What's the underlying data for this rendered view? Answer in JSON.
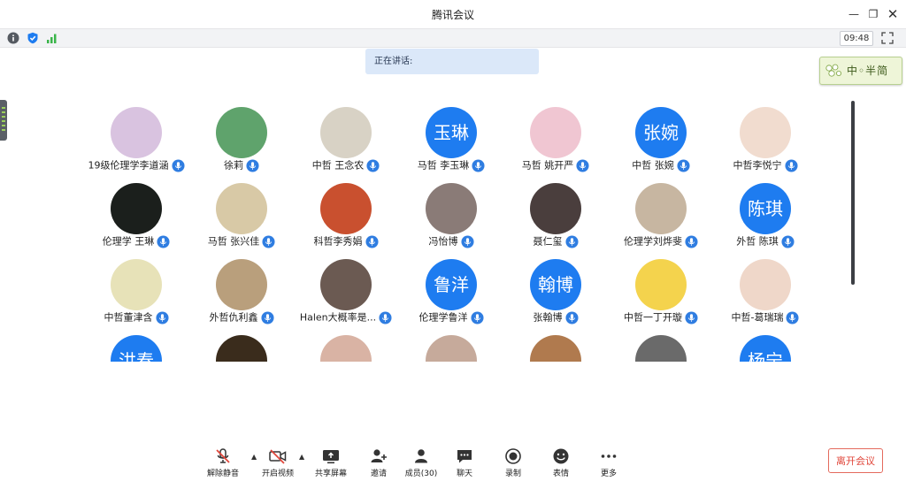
{
  "window": {
    "title": "腾讯会议",
    "minimize": "—",
    "restore": "❐",
    "close": "✕"
  },
  "infobar": {
    "time": "09:48",
    "colors": {
      "info": "#555a61",
      "shield": "#1e7cf0",
      "signal": "#3bb54a"
    }
  },
  "speaking": {
    "label": "正在讲话:"
  },
  "logo": {
    "text": "中◦半简"
  },
  "participants": [
    {
      "name": "19级伦理学李道涵",
      "avatar_text": "",
      "avatar_color": "#d9c3e0"
    },
    {
      "name": "徐莉",
      "avatar_text": "",
      "avatar_color": "#5fa36c"
    },
    {
      "name": "中哲 王念农",
      "avatar_text": "",
      "avatar_color": "#d8d2c5"
    },
    {
      "name": "马哲 李玉琳",
      "avatar_text": "玉琳",
      "avatar_color": "#1e7cf0"
    },
    {
      "name": "马哲 姚开严",
      "avatar_text": "",
      "avatar_color": "#f0c6d2"
    },
    {
      "name": "中哲 张婉",
      "avatar_text": "张婉",
      "avatar_color": "#1e7cf0"
    },
    {
      "name": "中哲李悦宁",
      "avatar_text": "",
      "avatar_color": "#f1dccf"
    },
    {
      "name": "伦理学 王琳",
      "avatar_text": "",
      "avatar_color": "#1b1f1c"
    },
    {
      "name": "马哲 张兴佳",
      "avatar_text": "",
      "avatar_color": "#d8c9a6"
    },
    {
      "name": "科哲李秀娟",
      "avatar_text": "",
      "avatar_color": "#c9502f"
    },
    {
      "name": "冯怡博",
      "avatar_text": "",
      "avatar_color": "#8a7b77"
    },
    {
      "name": "聂仁玺",
      "avatar_text": "",
      "avatar_color": "#4a3e3d"
    },
    {
      "name": "伦理学刘烨斐",
      "avatar_text": "",
      "avatar_color": "#c7b6a1"
    },
    {
      "name": "外哲 陈琪",
      "avatar_text": "陈琪",
      "avatar_color": "#1e7cf0"
    },
    {
      "name": "中哲董津含",
      "avatar_text": "",
      "avatar_color": "#e7e2b8"
    },
    {
      "name": "外哲仇利鑫",
      "avatar_text": "",
      "avatar_color": "#b99f7c"
    },
    {
      "name": "Halen大概率是...",
      "avatar_text": "",
      "avatar_color": "#6b5a52"
    },
    {
      "name": "伦理学鲁洋",
      "avatar_text": "鲁洋",
      "avatar_color": "#1e7cf0"
    },
    {
      "name": "张翰博",
      "avatar_text": "翰博",
      "avatar_color": "#1e7cf0"
    },
    {
      "name": "中哲一丁开璇",
      "avatar_text": "",
      "avatar_color": "#f4d34d"
    },
    {
      "name": "中哲-葛瑞瑞",
      "avatar_text": "",
      "avatar_color": "#efd7c9"
    },
    {
      "name": "",
      "avatar_text": "洪春",
      "avatar_color": "#1e7cf0"
    },
    {
      "name": "",
      "avatar_text": "",
      "avatar_color": "#3a2c1c"
    },
    {
      "name": "",
      "avatar_text": "",
      "avatar_color": "#d9b3a4"
    },
    {
      "name": "",
      "avatar_text": "",
      "avatar_color": "#c6aa9b"
    },
    {
      "name": "",
      "avatar_text": "",
      "avatar_color": "#b07a4e"
    },
    {
      "name": "",
      "avatar_text": "",
      "avatar_color": "#6a6a6a"
    },
    {
      "name": "",
      "avatar_text": "杨宁",
      "avatar_color": "#1e7cf0"
    }
  ],
  "toolbar": {
    "unmute": "解除静音",
    "start_video": "开启视频",
    "share_screen": "共享屏幕",
    "invite": "邀请",
    "members": "成员(30)",
    "chat": "聊天",
    "record": "录制",
    "reactions": "表情",
    "more": "更多",
    "leave": "离开会议"
  }
}
